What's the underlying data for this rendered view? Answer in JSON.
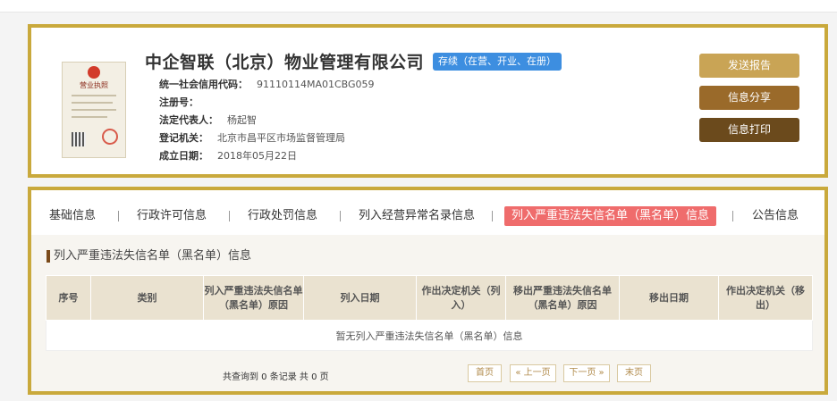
{
  "company": {
    "name": "中企智联（北京）物业管理有限公司",
    "status": "存续（在营、开业、在册）",
    "license_label": "营业执照",
    "fields": [
      {
        "label": "统一社会信用代码：",
        "value": "91110114MA01CBG059"
      },
      {
        "label": "注册号：",
        "value": ""
      },
      {
        "label": "法定代表人：",
        "value": "杨起智"
      },
      {
        "label": "登记机关：",
        "value": "北京市昌平区市场监督管理局"
      },
      {
        "label": "成立日期：",
        "value": "2018年05月22日"
      }
    ]
  },
  "actions": {
    "report": "发送报告",
    "share": "信息分享",
    "print": "信息打印"
  },
  "tabs": [
    "基础信息",
    "行政许可信息",
    "行政处罚信息",
    "列入经营异常名录信息",
    "列入严重违法失信名单（黑名单）信息",
    "公告信息"
  ],
  "section": {
    "title": "列入严重违法失信名单（黑名单）信息",
    "columns": [
      "序号",
      "类别",
      "列入严重违法失信名单（黑名单）原因",
      "列入日期",
      "作出决定机关（列入）",
      "移出严重违法失信名单（黑名单）原因",
      "移出日期",
      "作出决定机关（移出）"
    ],
    "empty_text": "暂无列入严重违法失信名单（黑名单）信息"
  },
  "pager": {
    "summary": "共查询到 0 条记录 共 0 页",
    "first": "首页",
    "prev": "« 上一页",
    "next": "下一页 »",
    "last": "末页"
  },
  "colors": {
    "frame": "#c9a93c",
    "active_tab": "#ef6c6c",
    "status_badge": "#3d8ee0"
  }
}
